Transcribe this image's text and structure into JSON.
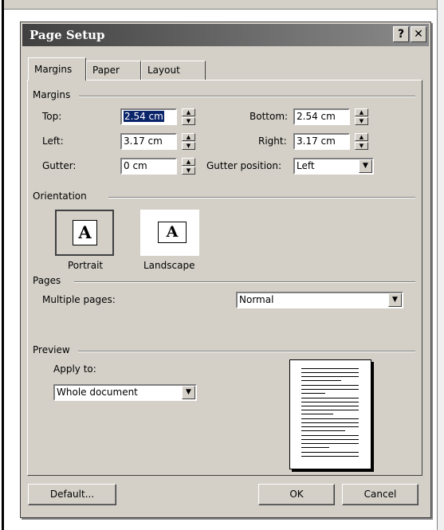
{
  "dialog": {
    "title": "Page Setup",
    "help_glyph": "?",
    "close_glyph": "✕"
  },
  "tabs": [
    {
      "label": "Margins",
      "active": true
    },
    {
      "label": "Paper",
      "active": false
    },
    {
      "label": "Layout",
      "active": false
    }
  ],
  "margins": {
    "group_label": "Margins",
    "top_label": "Top:",
    "top_value": "2.54 cm",
    "bottom_label": "Bottom:",
    "bottom_value": "2.54 cm",
    "left_label": "Left:",
    "left_value": "3.17 cm",
    "right_label": "Right:",
    "right_value": "3.17 cm",
    "gutter_label": "Gutter:",
    "gutter_value": "0 cm",
    "gutter_position_label": "Gutter position:",
    "gutter_position_value": "Left"
  },
  "orientation": {
    "group_label": "Orientation",
    "portrait_label": "Portrait",
    "landscape_label": "Landscape",
    "icon_letter": "A",
    "selected": "Portrait"
  },
  "pages": {
    "group_label": "Pages",
    "multiple_pages_label": "Multiple pages:",
    "multiple_pages_value": "Normal"
  },
  "preview": {
    "group_label": "Preview",
    "apply_to_label": "Apply to:",
    "apply_to_value": "Whole document"
  },
  "buttons": {
    "default": "Default...",
    "ok": "OK",
    "cancel": "Cancel"
  },
  "colors": {
    "dialog_face": "#d4d0c8",
    "titlebar": "#404040",
    "selection": "#0a246a"
  },
  "icons": {
    "spin_up": "▲",
    "spin_down": "▼",
    "dropdown": "▼"
  }
}
